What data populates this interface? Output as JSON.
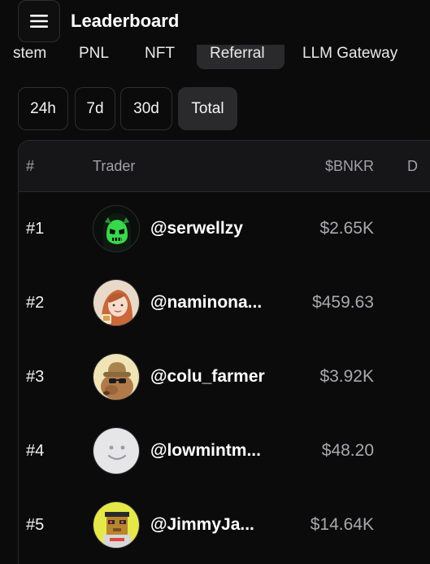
{
  "header": {
    "title": "Leaderboard",
    "menu_icon": "hamburger-menu-icon"
  },
  "category_tabs": [
    {
      "label": "stem",
      "active": false
    },
    {
      "label": "PNL",
      "active": false
    },
    {
      "label": "NFT",
      "active": false
    },
    {
      "label": "Referral",
      "active": true
    },
    {
      "label": "LLM Gateway",
      "active": false
    }
  ],
  "range_tabs": [
    {
      "label": "24h",
      "active": false
    },
    {
      "label": "7d",
      "active": false
    },
    {
      "label": "30d",
      "active": false
    },
    {
      "label": "Total",
      "active": true
    }
  ],
  "table": {
    "columns": [
      "#",
      "Trader",
      "$BNKR",
      "D"
    ],
    "rows": [
      {
        "rank": "#1",
        "handle": "@serwellzy",
        "amount": "$2.65K",
        "avatar": "hooded-green-skull-avatar"
      },
      {
        "rank": "#2",
        "handle": "@naminona...",
        "amount": "$459.63",
        "avatar": "red-haired-girl-avatar"
      },
      {
        "rank": "#3",
        "handle": "@colu_farmer",
        "amount": "$3.92K",
        "avatar": "capybara-cowboy-avatar"
      },
      {
        "rank": "#4",
        "handle": "@lowmintm...",
        "amount": "$48.20",
        "avatar": "default-smiley-avatar"
      },
      {
        "rank": "#5",
        "handle": "@JimmyJa...",
        "amount": "$14.64K",
        "avatar": "pixel-cat-avatar"
      }
    ]
  },
  "colors": {
    "background": "#0b0b0c",
    "active_tab": "#2a2a2d",
    "header_row": "#161618",
    "muted_text": "#a1a1a6"
  }
}
